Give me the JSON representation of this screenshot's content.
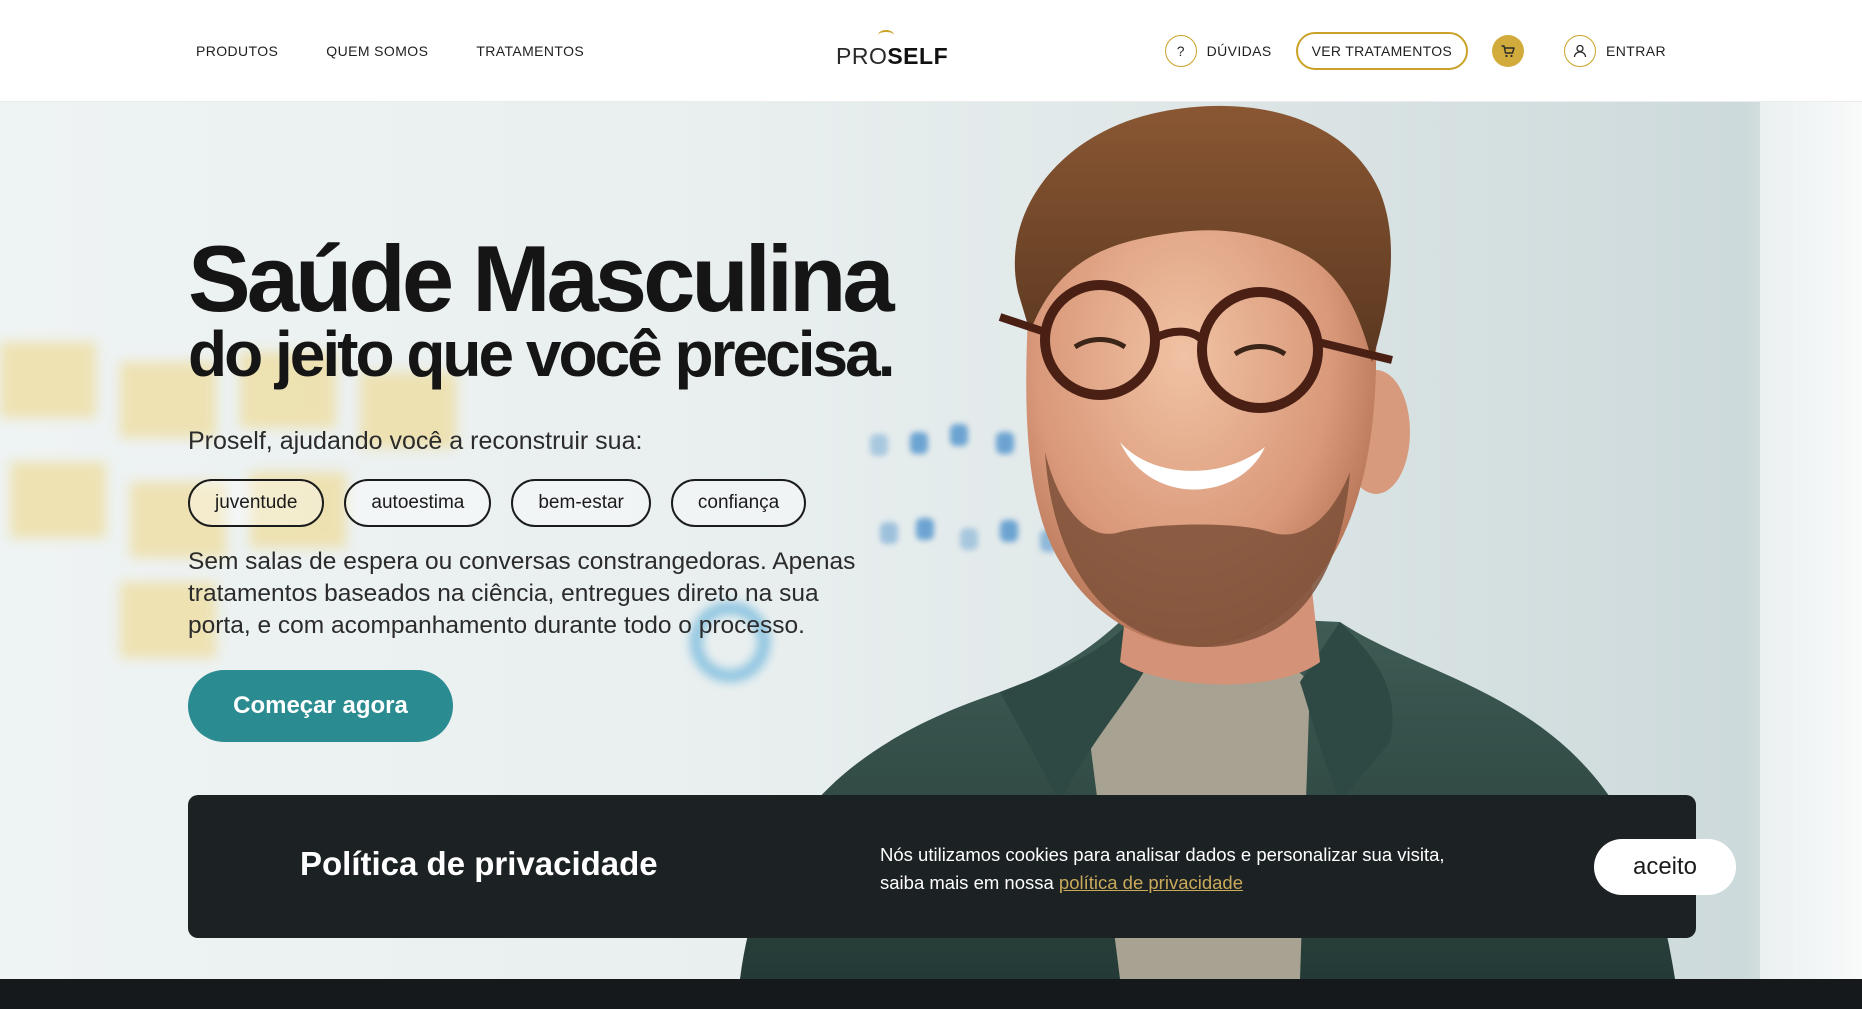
{
  "header": {
    "nav": [
      {
        "label": "PRODUTOS"
      },
      {
        "label": "QUEM SOMOS"
      },
      {
        "label": "TRATAMENTOS"
      }
    ],
    "logo_pro": "PRO",
    "logo_self": "SELF",
    "help_icon_glyph": "?",
    "help_label": "DÚVIDAS",
    "view_treatments_label": "VER TRATAMENTOS",
    "login_label": "ENTRAR"
  },
  "hero": {
    "title_line1": "Saúde Masculina",
    "title_line2": "do jeito que você precisa.",
    "subtitle": "Proself, ajudando você a reconstruir sua:",
    "pills": [
      {
        "label": "juventude"
      },
      {
        "label": "autoestima"
      },
      {
        "label": "bem-estar"
      },
      {
        "label": "confiança"
      }
    ],
    "description": "Sem salas de espera ou conversas constrangedoras. Apenas tratamentos baseados na ciência, entregues direto na sua porta, e com acompanhamento durante todo o processo.",
    "cta_label": "Começar agora"
  },
  "cookie": {
    "title": "Política de privacidade",
    "text": "Nós utilizamos cookies para analisar dados e personalizar sua visita, saiba mais em nossa ",
    "link_label": "política de privacidade",
    "accept_label": "aceito"
  },
  "colors": {
    "accent_gold": "#c9a227",
    "cta_teal": "#2a8b91",
    "cookie_bg": "#1c2124",
    "link_gold": "#c9a95a"
  },
  "icons": [
    "question-icon",
    "cart-icon",
    "user-icon"
  ]
}
